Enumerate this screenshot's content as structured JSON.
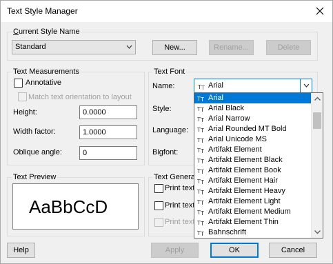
{
  "window": {
    "title": "Text Style Manager"
  },
  "current_style": {
    "group_label": "Current Style Name",
    "value": "Standard",
    "new_label": "New...",
    "rename_label": "Rename...",
    "delete_label": "Delete"
  },
  "measurements": {
    "group_label": "Text Measurements",
    "annotative_label": "Annotative",
    "annotative_checked": false,
    "match_label": "Match text orientation to layout",
    "match_checked": false,
    "height_label": "Height:",
    "height_value": "0.0000",
    "width_label": "Width factor:",
    "width_value": "1.0000",
    "oblique_label": "Oblique angle:",
    "oblique_value": "0"
  },
  "font": {
    "group_label": "Text Font",
    "name_label": "Name:",
    "name_value": "Arial",
    "style_label": "Style:",
    "language_label": "Language:",
    "bigfont_label": "Bigfont:"
  },
  "preview": {
    "group_label": "Text Preview",
    "sample": "AaBbCcD"
  },
  "generation": {
    "group_label": "Text Genera",
    "option1": "Print text",
    "option2": "Print text",
    "option3": "Print text"
  },
  "font_list": {
    "selected_index": 0,
    "items": [
      "Arial",
      "Arial Black",
      "Arial Narrow",
      "Arial Rounded MT Bold",
      "Arial Unicode MS",
      "Artifakt Element",
      "Artifakt Element Black",
      "Artifakt Element Book",
      "Artifakt Element Hair",
      "Artifakt Element Heavy",
      "Artifakt Element Light",
      "Artifakt Element Medium",
      "Artifakt Element Thin",
      "Bahnschrift"
    ]
  },
  "footer": {
    "help_label": "Help",
    "apply_label": "Apply",
    "ok_label": "OK",
    "cancel_label": "Cancel"
  },
  "colors": {
    "accent": "#0078d7",
    "dropdown_border": "#646464"
  }
}
